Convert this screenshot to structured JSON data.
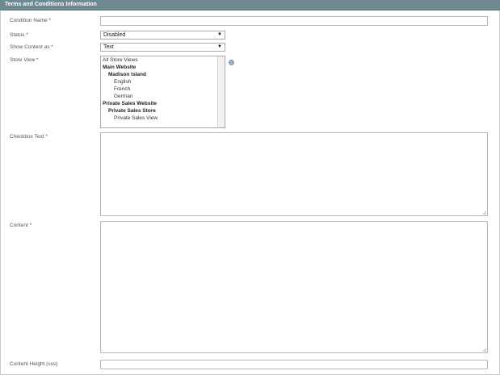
{
  "section": {
    "title": "Terms and Conditions Information"
  },
  "fields": {
    "condition_name": {
      "label": "Condition Name *",
      "value": ""
    },
    "status": {
      "label": "Status *",
      "value": "Disabled"
    },
    "show_content_as": {
      "label": "Show Content as *",
      "value": "Text"
    },
    "store_view": {
      "label": "Store View *",
      "options": [
        {
          "text": "All Store Views",
          "level": 0,
          "bold": false
        },
        {
          "text": "Main Website",
          "level": 0,
          "bold": true
        },
        {
          "text": "Madison Island",
          "level": 1,
          "bold": true
        },
        {
          "text": "English",
          "level": 2,
          "bold": false
        },
        {
          "text": "French",
          "level": 2,
          "bold": false
        },
        {
          "text": "German",
          "level": 2,
          "bold": false
        },
        {
          "text": "Private Sales Website",
          "level": 0,
          "bold": true
        },
        {
          "text": "Private Sales Store",
          "level": 1,
          "bold": true
        },
        {
          "text": "Private Sales View",
          "level": 2,
          "bold": false
        }
      ]
    },
    "checkbox_text": {
      "label": "Checkbox Text *",
      "value": ""
    },
    "content": {
      "label": "Content *",
      "value": ""
    },
    "content_height": {
      "label": "Content Height (css)",
      "value": ""
    }
  },
  "icons": {
    "dropdown": "chevron-down-icon",
    "help": "help-icon",
    "resize": "resize-grip-icon"
  },
  "colors": {
    "header_bg": "#6f8992",
    "header_text": "#ffffff",
    "border": "#b7b7b7"
  }
}
